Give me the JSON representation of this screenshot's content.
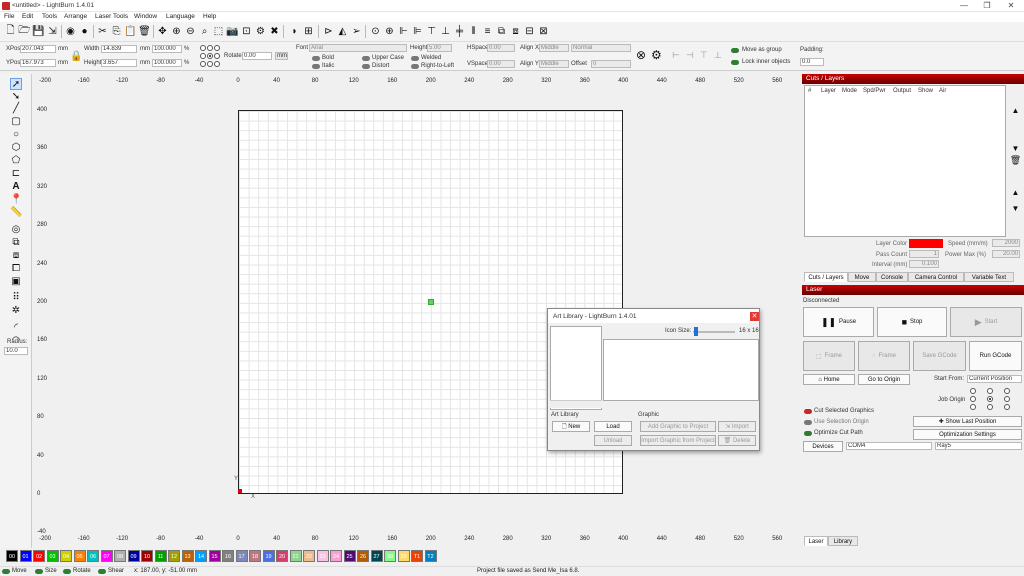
{
  "window": {
    "title": "<untitled> - LightBurn 1.4.01",
    "min": "—",
    "max": "❐",
    "close": "✕"
  },
  "menu": [
    "File",
    "Edit",
    "Tools",
    "Arrange",
    "Laser Tools",
    "Window",
    "Language",
    "Help"
  ],
  "props": {
    "xpos_label": "XPos",
    "xpos": "207.043",
    "ypos_label": "YPos",
    "ypos": "167.973",
    "unit": "mm",
    "width_label": "Width",
    "width": "14.839",
    "height_label": "Height",
    "height": "3.657",
    "scale_w": "100.000",
    "scale_h": "100.000",
    "pct": "%",
    "rotate_label": "Rotate",
    "rotate": "0.00",
    "rot_unit": "mm",
    "font_label": "Font",
    "font": "Arial",
    "fheight_label": "Height",
    "fheight": "5.00",
    "bold": "Bold",
    "italic": "Italic",
    "upper": "Upper Case",
    "distort": "Distort",
    "welded": "Welded",
    "rtl": "Right-to-Left",
    "hspace_label": "HSpace",
    "hspace": "0.00",
    "vspace_label": "VSpace",
    "vspace": "0.00",
    "alignx_label": "Align X",
    "alignx": "Middle",
    "aligny_label": "Align Y",
    "aligny": "Middle",
    "normal": "Normal",
    "offset_label": "Offset",
    "offset": "0",
    "move_group": "Move as group",
    "lock_inner": "Lock inner objects",
    "padding_label": "Padding:",
    "padding": "0.0"
  },
  "ruler": {
    "top": [
      "-200",
      "-160",
      "-120",
      "-80",
      "-40",
      "0",
      "40",
      "80",
      "120",
      "160",
      "200",
      "240",
      "280",
      "320",
      "360",
      "400",
      "440",
      "480",
      "520",
      "560"
    ],
    "bottom": [
      "-200",
      "-160",
      "-120",
      "-80",
      "-40",
      "0",
      "40",
      "80",
      "120",
      "160",
      "200",
      "240",
      "280",
      "320",
      "360",
      "400",
      "440",
      "480",
      "520",
      "560"
    ],
    "left": [
      "400",
      "360",
      "320",
      "280",
      "240",
      "200",
      "160",
      "120",
      "80",
      "40",
      "0",
      "-40"
    ]
  },
  "lefttools": {
    "radius_label": "Radius:",
    "radius": "10.0"
  },
  "axes": {
    "y": "Y",
    "x": "X"
  },
  "artlib": {
    "title": "Art Library - LightBurn 1.4.01",
    "icon_size_label": "Icon Size:",
    "icon_size": "16 x 16",
    "section_lib": "Art Library",
    "section_graphic": "Graphic",
    "new": "New",
    "load": "Load",
    "unload": "Unload",
    "add": "Add Graphic to Project",
    "import": "Import",
    "import_from": "Import Graphic from Project",
    "delete": "Delete"
  },
  "cuts": {
    "title": "Cuts / Layers",
    "cols": [
      "#",
      "Layer",
      "Mode",
      "Spd/Pwr",
      "Output",
      "Show",
      "Air"
    ],
    "layer_color": "Layer Color",
    "speed_label": "Speed (mm/m)",
    "speed": "2000",
    "pass_label": "Pass Count",
    "pass": "1",
    "powermax_label": "Power Max (%)",
    "powermax": "20.00",
    "interval_label": "Interval (mm)",
    "interval": "0.100",
    "tabs": [
      "Cuts / Layers",
      "Move",
      "Console",
      "Camera Control",
      "Variable Text"
    ]
  },
  "laser": {
    "title": "Laser",
    "status": "Disconnected",
    "pause": "Pause",
    "stop": "Stop",
    "start": "Start",
    "frame1": "Frame",
    "frame2": "Frame",
    "save_gcode": "Save GCode",
    "run_gcode": "Run GCode",
    "home": "Home",
    "goto_origin": "Go to Origin",
    "start_from_label": "Start From:",
    "start_from": "Current Position",
    "job_origin": "Job Origin",
    "cut_selected": "Cut Selected Graphics",
    "use_selection": "Use Selection Origin",
    "show_last": "Show Last Position",
    "optimize": "Optimize Cut Path",
    "opt_settings": "Optimization Settings",
    "devices": "Devices",
    "port": "COM4",
    "device": "Ray5",
    "tabs": [
      "Laser",
      "Library"
    ]
  },
  "palette": [
    {
      "l": "00",
      "c": "#000000"
    },
    {
      "l": "01",
      "c": "#0000ff"
    },
    {
      "l": "02",
      "c": "#ff0000"
    },
    {
      "l": "03",
      "c": "#00c000"
    },
    {
      "l": "04",
      "c": "#d0d000"
    },
    {
      "l": "05",
      "c": "#ff8000"
    },
    {
      "l": "06",
      "c": "#00c0c0"
    },
    {
      "l": "07",
      "c": "#ff00ff"
    },
    {
      "l": "08",
      "c": "#b0b0b0"
    },
    {
      "l": "09",
      "c": "#0000a0"
    },
    {
      "l": "10",
      "c": "#a00000"
    },
    {
      "l": "11",
      "c": "#00a000"
    },
    {
      "l": "12",
      "c": "#a0a000"
    },
    {
      "l": "13",
      "c": "#c06000"
    },
    {
      "l": "14",
      "c": "#00a0ff"
    },
    {
      "l": "15",
      "c": "#a000a0"
    },
    {
      "l": "16",
      "c": "#808080"
    },
    {
      "l": "17",
      "c": "#7d87b9"
    },
    {
      "l": "18",
      "c": "#bb7784"
    },
    {
      "l": "19",
      "c": "#4a6fe3"
    },
    {
      "l": "20",
      "c": "#d33f6a"
    },
    {
      "l": "21",
      "c": "#8cd78c"
    },
    {
      "l": "22",
      "c": "#f0b98d"
    },
    {
      "l": "23",
      "c": "#f6c4e1"
    },
    {
      "l": "24",
      "c": "#fa9ed4"
    },
    {
      "l": "25",
      "c": "#500a78"
    },
    {
      "l": "26",
      "c": "#b45a00"
    },
    {
      "l": "27",
      "c": "#004754"
    },
    {
      "l": "28",
      "c": "#86fa88"
    },
    {
      "l": "29",
      "c": "#ffdb66"
    },
    {
      "l": "T1",
      "c": "#f04000"
    },
    {
      "l": "T2",
      "c": "#0080c0"
    }
  ],
  "status": {
    "move": "Move",
    "size": "Size",
    "rotate": "Rotate",
    "shear": "Shear",
    "coords": "x: 187.00, y: -51.00 mm",
    "message": "Project file saved as Send Me_Isa 6.8."
  }
}
